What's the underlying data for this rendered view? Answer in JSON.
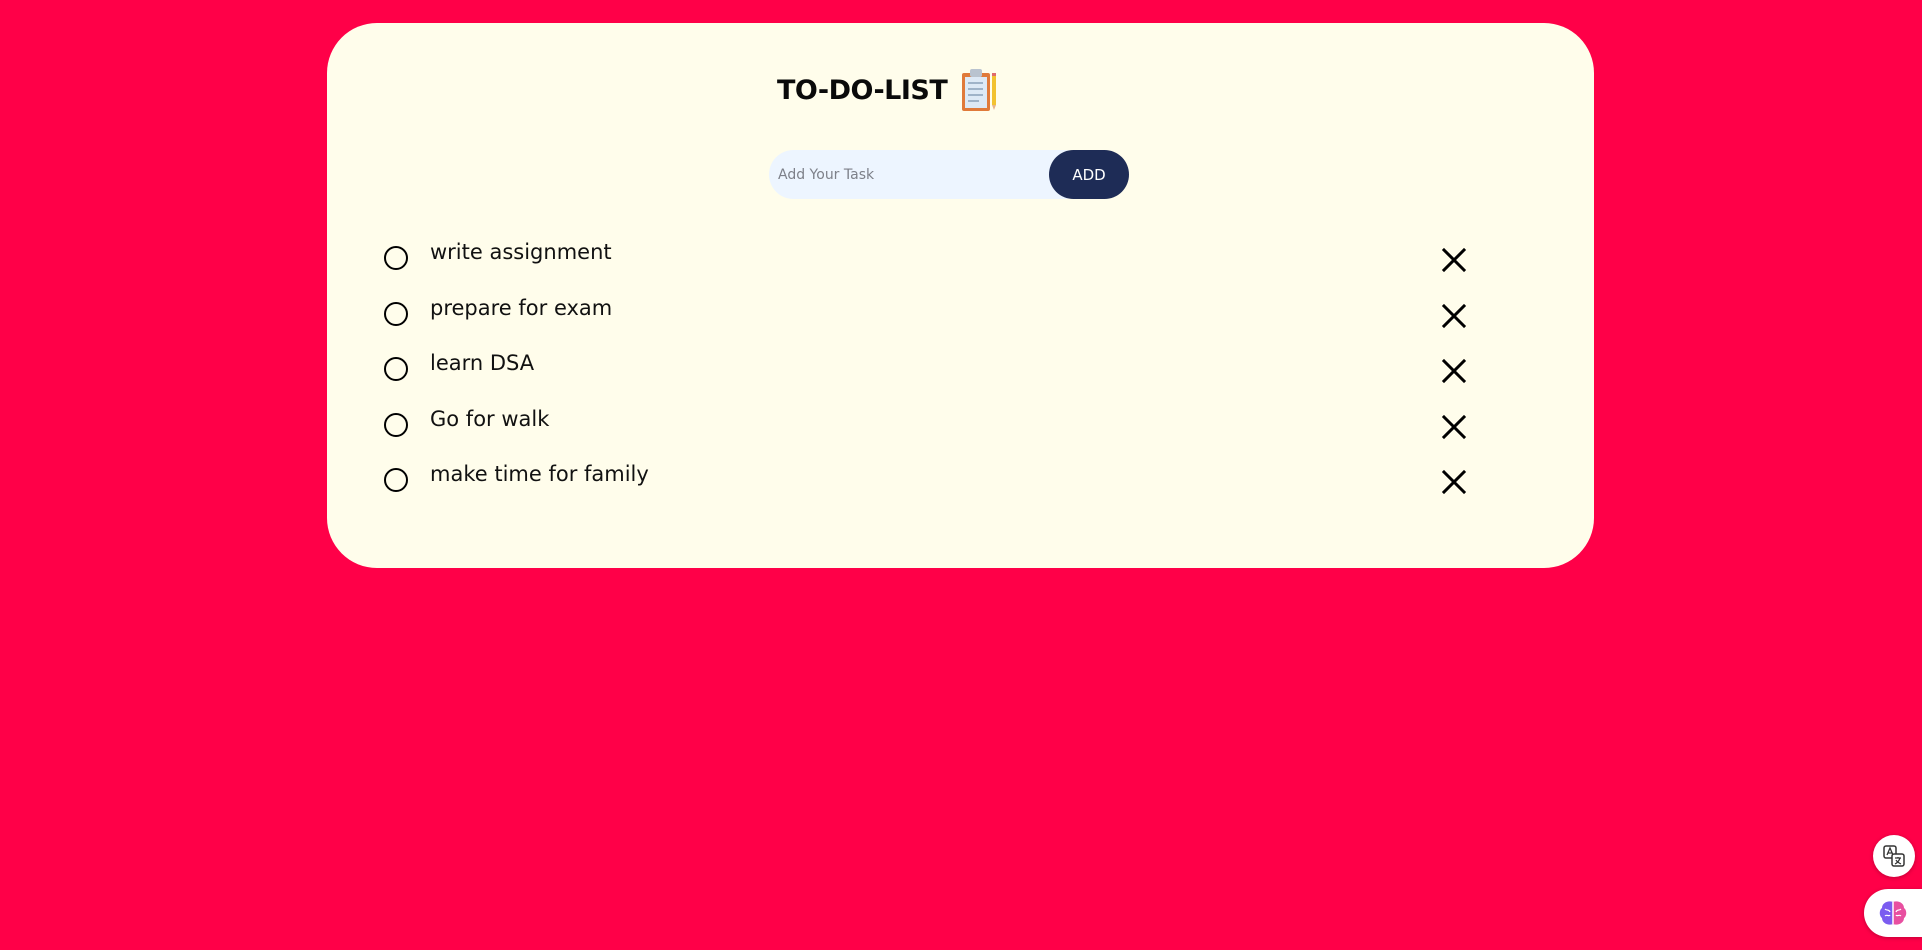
{
  "app": {
    "title": "TO-DO-LIST",
    "title_icon": "clipboard-icon"
  },
  "input": {
    "placeholder": "Add Your Task",
    "value": ""
  },
  "add_button": {
    "label": "ADD"
  },
  "tasks": [
    {
      "text": "write assignment",
      "done": false
    },
    {
      "text": "prepare for exam",
      "done": false
    },
    {
      "text": "learn DSA",
      "done": false
    },
    {
      "text": "Go for walk",
      "done": false
    },
    {
      "text": "make time for family",
      "done": false
    }
  ],
  "floating": {
    "translate_icon": "translate-icon",
    "brain_icon": "brain-icon"
  },
  "colors": {
    "background": "#ff0048",
    "card": "#fffdeb",
    "input_bg": "#edf5ff",
    "button": "#1e2c56"
  }
}
